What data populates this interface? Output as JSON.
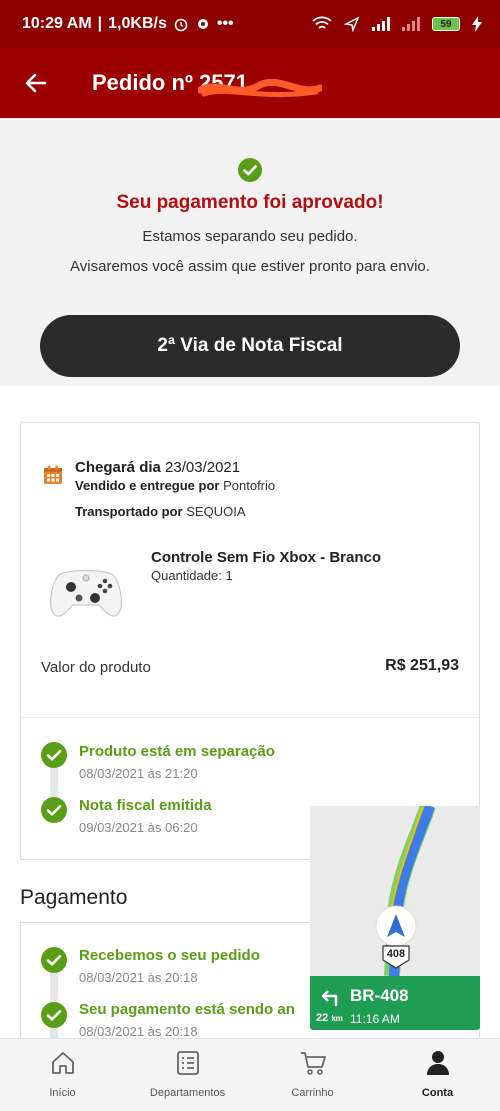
{
  "status_bar": {
    "time": "10:29 AM",
    "speed": "1,0KB/s",
    "battery": "59"
  },
  "header": {
    "title": "Pedido nº 2571"
  },
  "approval": {
    "headline": "Seu pagamento foi aprovado!",
    "line1": "Estamos separando seu pedido.",
    "line2": "Avisaremos você assim que estiver pronto para envio.",
    "button": "2ª Via de Nota Fiscal"
  },
  "delivery": {
    "arrives_label": "Chegará dia",
    "arrives_date": "23/03/2021",
    "sold_label": "Vendido e entregue por",
    "seller": "Pontofrio",
    "transport_label": "Transportado por",
    "carrier": "SEQUOIA"
  },
  "product": {
    "name": "Controle Sem Fio Xbox - Branco",
    "quantity": "Quantidade: 1",
    "value_label": "Valor do produto",
    "value": "R$ 251,93"
  },
  "tracking": [
    {
      "title": "Produto está em separação",
      "date": "08/03/2021 às 21:20"
    },
    {
      "title": "Nota fiscal emitida",
      "date": "09/03/2021 às 06:20"
    }
  ],
  "payment": {
    "title": "Pagamento",
    "steps": [
      {
        "title": "Recebemos o seu pedido",
        "date": "08/03/2021 às 20:18"
      },
      {
        "title": "Seu pagamento está sendo an",
        "date": "08/03/2021 às 20:18"
      }
    ]
  },
  "map": {
    "road": "BR-408",
    "shield": "408",
    "distance": "22",
    "distance_unit": "km",
    "time": "11:16 AM"
  },
  "nav": {
    "items": [
      {
        "label": "Início",
        "icon": "home-icon"
      },
      {
        "label": "Departamentos",
        "icon": "list-icon"
      },
      {
        "label": "Carrinho",
        "icon": "cart-icon"
      },
      {
        "label": "Conta",
        "icon": "user-icon"
      }
    ]
  },
  "colors": {
    "header_bg": "#9d0000",
    "status_bg": "#8e0000",
    "accent_red": "#b30f0f",
    "success_green": "#5a9e16",
    "button_dark": "#2b2b2b"
  }
}
